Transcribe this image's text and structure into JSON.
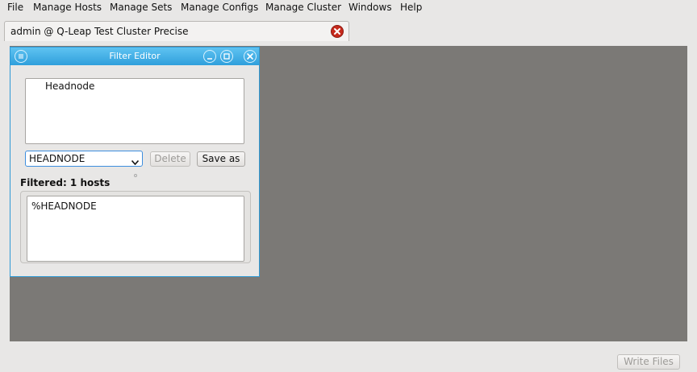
{
  "menubar": {
    "items": [
      "File",
      "Manage Hosts",
      "Manage Sets",
      "Manage Configs",
      "Manage Cluster",
      "Windows",
      "Help"
    ]
  },
  "tab": {
    "label": "admin @ Q-Leap Test Cluster Precise",
    "close_icon": "close-icon",
    "close_color": "#c62a1d"
  },
  "filter_editor": {
    "title": "Filter Editor",
    "list_items": [
      "Headnode"
    ],
    "selected_filter": "HEADNODE",
    "delete_label": "Delete",
    "save_as_label": "Save as",
    "filtered_label": "Filtered: 1 hosts",
    "filter_text": "%HEADNODE"
  },
  "footer": {
    "write_files_label": "Write Files"
  },
  "colors": {
    "titlebar": "#2f9fdc",
    "mdi_background": "#7b7976"
  }
}
